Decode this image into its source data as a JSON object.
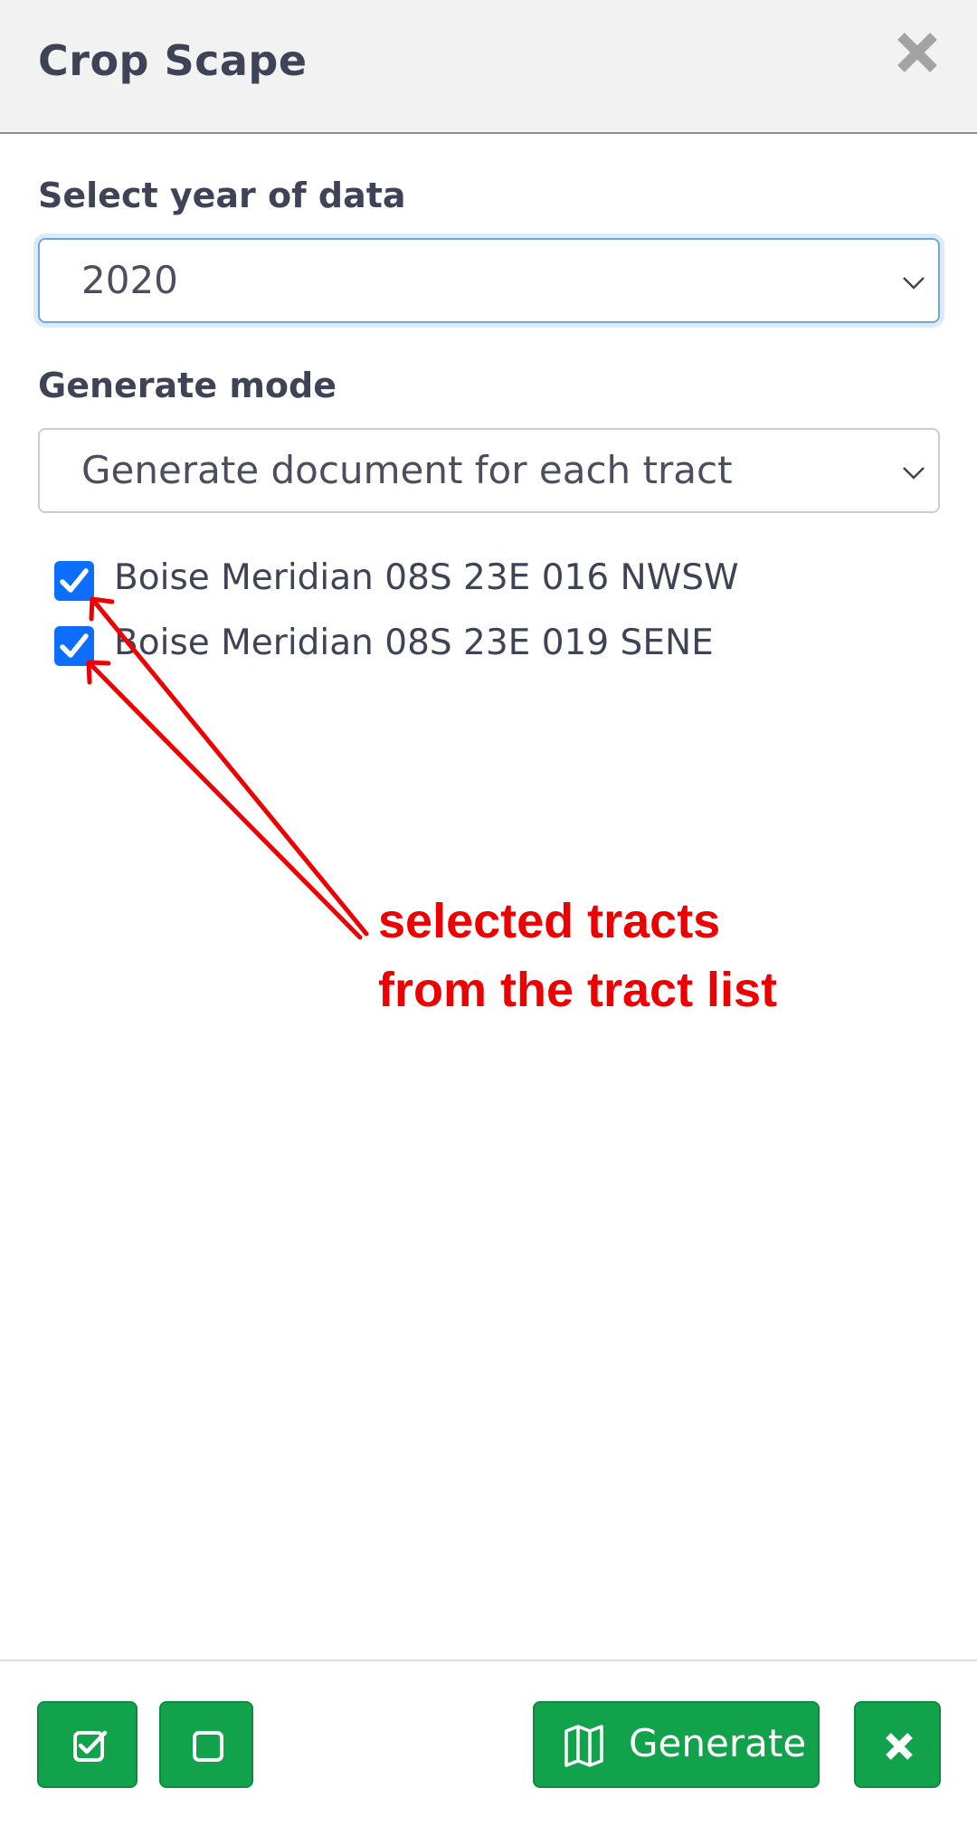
{
  "header": {
    "title": "Crop Scape"
  },
  "year_select": {
    "label": "Select year of data",
    "value": "2020"
  },
  "mode_select": {
    "label": "Generate mode",
    "value": "Generate document for each tract"
  },
  "tracts": [
    {
      "label": "Boise Meridian 08S 23E 016 NWSW",
      "checked": true
    },
    {
      "label": "Boise Meridian 08S 23E 019 SENE",
      "checked": true
    }
  ],
  "annotation": {
    "line1": "selected tracts",
    "line2": "from the tract list",
    "color": "#ee0000"
  },
  "footer": {
    "generate_label": "Generate"
  },
  "colors": {
    "accent_button": "#12a24b",
    "checkbox": "#0d6efd"
  }
}
